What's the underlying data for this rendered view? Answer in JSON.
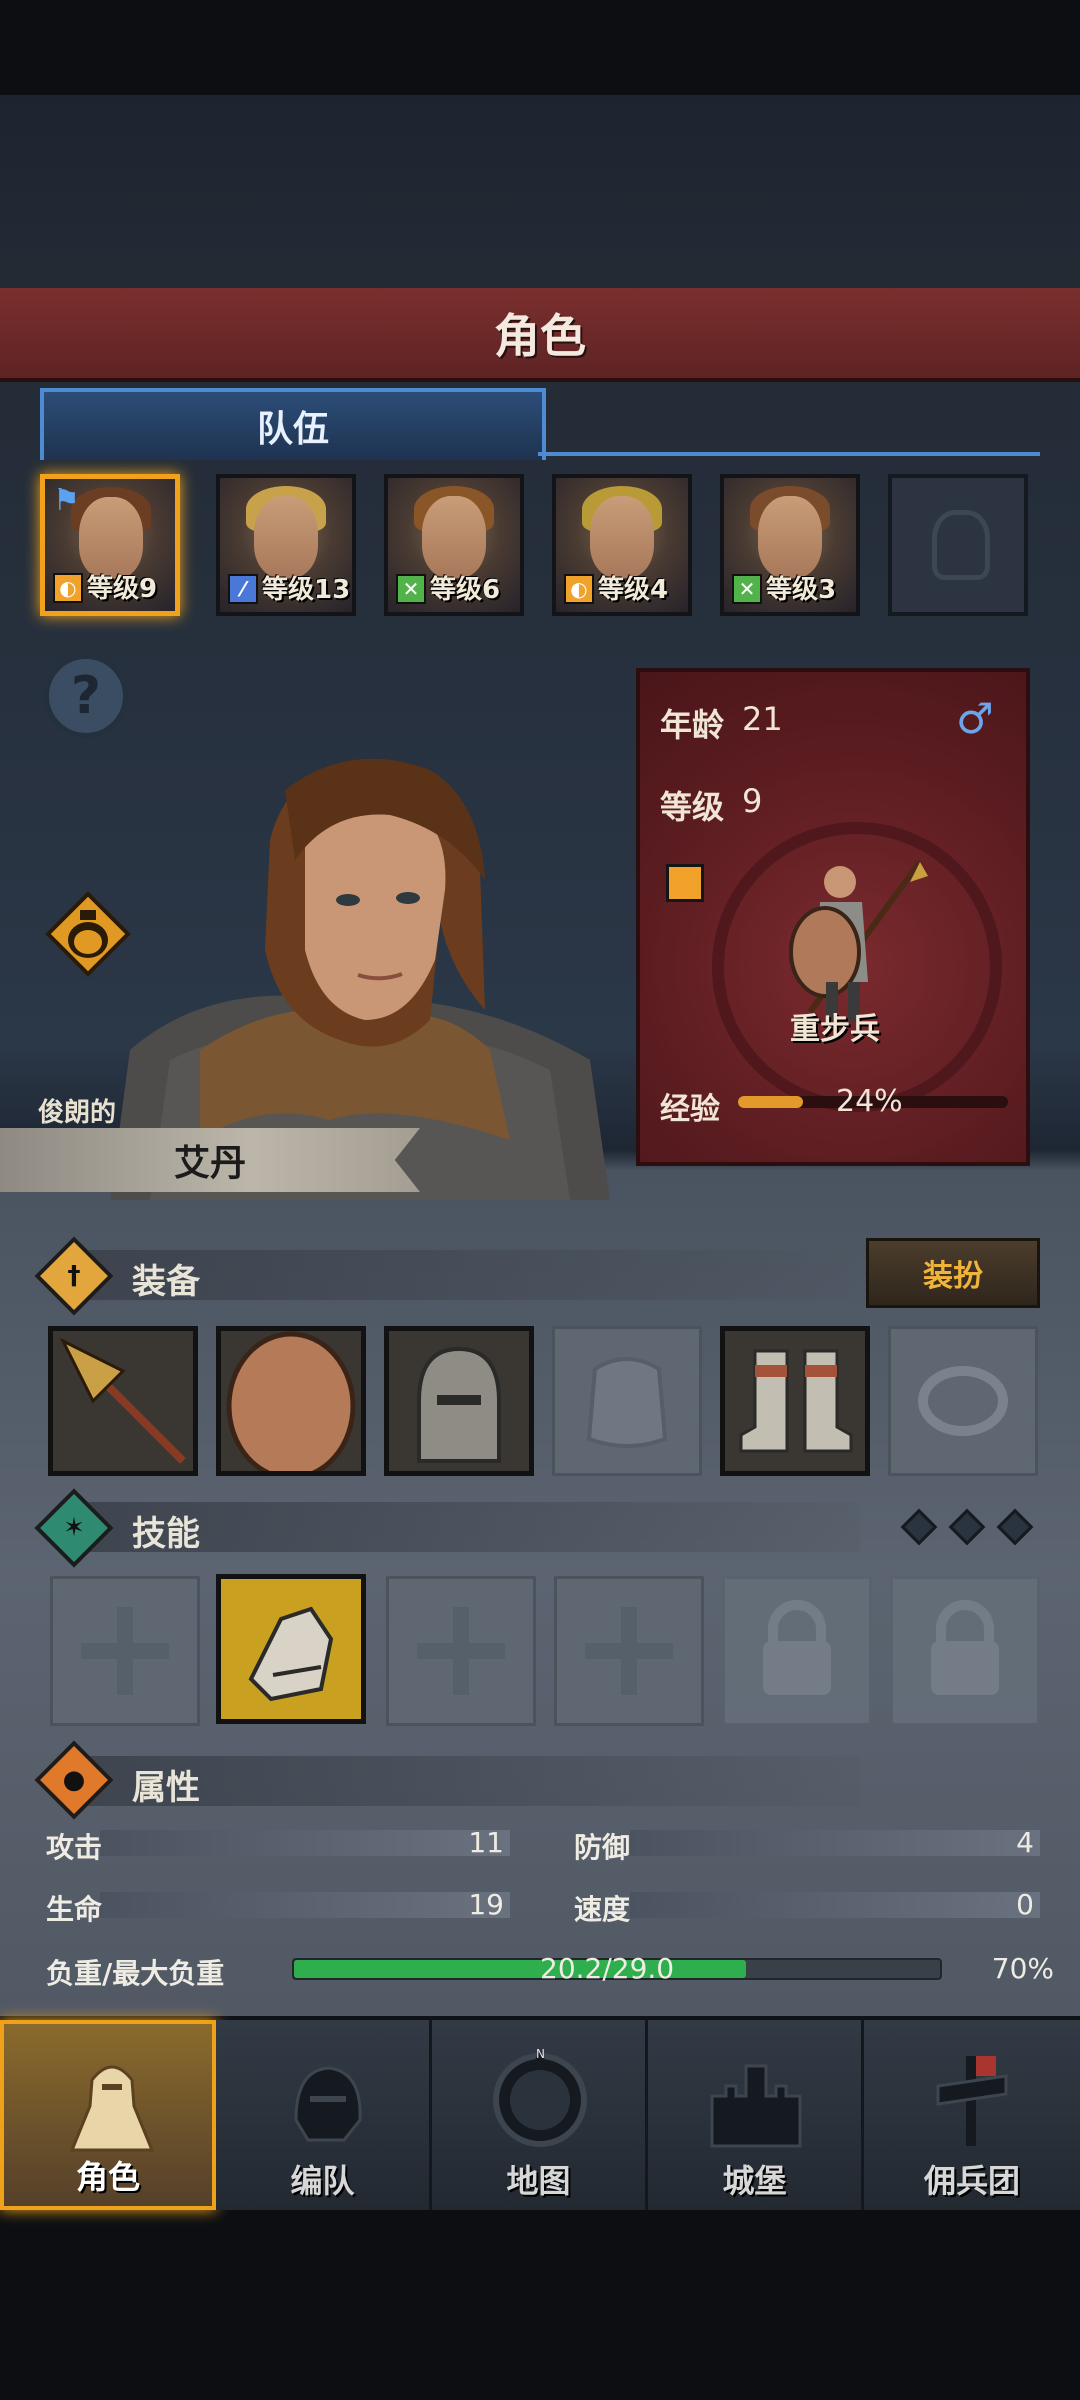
{
  "header": {
    "title": "角色"
  },
  "tabs": {
    "team": "队伍"
  },
  "roster": [
    {
      "level_text": "等级9",
      "badge": "shield",
      "badge_color": "#f0a22a",
      "hair": "#6b3d22",
      "selected": true
    },
    {
      "level_text": "等级13",
      "badge": "sword",
      "badge_color": "#4a78d8",
      "hair": "#c7a24a",
      "selected": false
    },
    {
      "level_text": "等级6",
      "badge": "cross-swords",
      "badge_color": "#52b34a",
      "hair": "#8a5628",
      "selected": false
    },
    {
      "level_text": "等级4",
      "badge": "shield",
      "badge_color": "#f0a22a",
      "hair": "#b89a36",
      "selected": false
    },
    {
      "level_text": "等级3",
      "badge": "cross-swords",
      "badge_color": "#52b34a",
      "hair": "#7a4c2c",
      "selected": false
    }
  ],
  "hero": {
    "title": "俊朗的",
    "name": "艾丹"
  },
  "class_card": {
    "age_label": "年龄",
    "age_value": "21",
    "gender": "♂",
    "level_label": "等级",
    "level_value": "9",
    "class_name": "重步兵",
    "exp_label": "经验",
    "exp_value": "24%",
    "exp_fraction": 0.24
  },
  "equipment": {
    "title": "装备",
    "outfit_button": "装扮",
    "slots": [
      "spear-icon",
      "shield-icon",
      "helmet-icon",
      "armor-slot-icon",
      "boots-icon",
      "ring-slot-icon"
    ]
  },
  "skills": {
    "title": "技能",
    "slots": [
      "empty",
      "gauntlet-skill",
      "empty",
      "empty",
      "locked",
      "locked"
    ]
  },
  "attributes": {
    "title": "属性",
    "attack_label": "攻击",
    "attack_value": "11",
    "defense_label": "防御",
    "defense_value": "4",
    "hp_label": "生命",
    "hp_value": "19",
    "speed_label": "速度",
    "speed_value": "0",
    "load_label": "负重/最大负重",
    "load_value": "20.2/29.0",
    "load_percent": "70%",
    "load_fraction": 0.7
  },
  "nav": [
    {
      "label": "角色",
      "icon": "knight-icon",
      "active": true
    },
    {
      "label": "编队",
      "icon": "helmet-squad-icon",
      "active": false
    },
    {
      "label": "地图",
      "icon": "compass-map-icon",
      "active": false
    },
    {
      "label": "城堡",
      "icon": "castle-icon",
      "active": false
    },
    {
      "label": "佣兵团",
      "icon": "mercenary-banner-icon",
      "active": false
    }
  ],
  "colors": {
    "accent": "#f0a11a",
    "tab_blue": "#4f8bd2",
    "header_red": "#6e2929",
    "load_green": "#2fae4e"
  }
}
